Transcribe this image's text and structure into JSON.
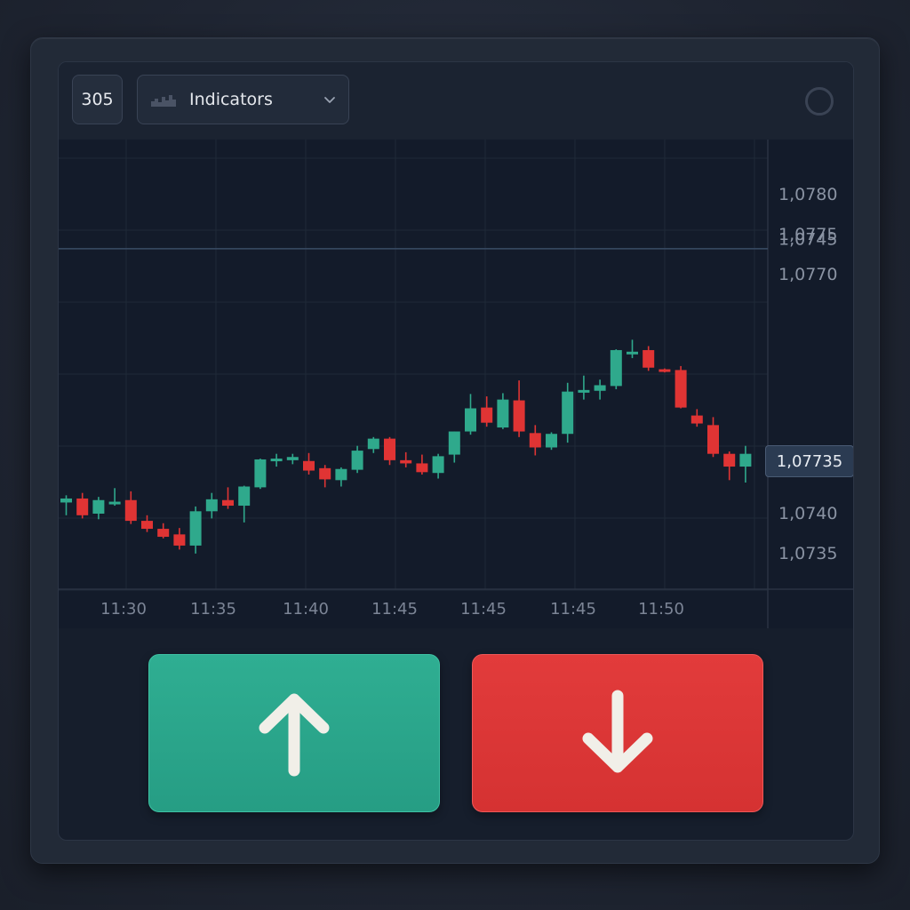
{
  "toolbar": {
    "timeframe_label": "305",
    "indicators_label": "Indicators",
    "indicators_icon": "bar-chart-icon",
    "dropdown_icon": "chevron-down-icon",
    "settings_icon": "circle-settings-icon"
  },
  "chart_data": {
    "type": "candlestick",
    "y_axis_labels": [
      "1,0780",
      "1,0775",
      "1,0770",
      "1,0745",
      "1,0740",
      "1,0735"
    ],
    "x_axis_labels": [
      "11:30",
      "11:35",
      "11:40",
      "11:45",
      "11:45",
      "11:45",
      "11:50"
    ],
    "current_price": "1,07735",
    "colors": {
      "up": "#2fa98c",
      "down": "#e03434",
      "background": "#131b2a",
      "grid": "#1f2938"
    },
    "candles": [
      {
        "dir": "up",
        "o": 1.07413,
        "h": 1.07422,
        "l": 1.07397,
        "c": 1.07418
      },
      {
        "dir": "down",
        "o": 1.07418,
        "h": 1.07425,
        "l": 1.07393,
        "c": 1.07397
      },
      {
        "dir": "up",
        "o": 1.07399,
        "h": 1.0742,
        "l": 1.07392,
        "c": 1.07416
      },
      {
        "dir": "up",
        "o": 1.07411,
        "h": 1.07431,
        "l": 1.07409,
        "c": 1.07414
      },
      {
        "dir": "down",
        "o": 1.07416,
        "h": 1.07427,
        "l": 1.07386,
        "c": 1.0739
      },
      {
        "dir": "down",
        "o": 1.0739,
        "h": 1.07397,
        "l": 1.07376,
        "c": 1.0738
      },
      {
        "dir": "down",
        "o": 1.0738,
        "h": 1.07387,
        "l": 1.07368,
        "c": 1.0737
      },
      {
        "dir": "down",
        "o": 1.07373,
        "h": 1.07381,
        "l": 1.07354,
        "c": 1.07359
      },
      {
        "dir": "up",
        "o": 1.07359,
        "h": 1.07408,
        "l": 1.07349,
        "c": 1.07402
      },
      {
        "dir": "up",
        "o": 1.07402,
        "h": 1.07425,
        "l": 1.07393,
        "c": 1.07417
      },
      {
        "dir": "down",
        "o": 1.07416,
        "h": 1.07432,
        "l": 1.07405,
        "c": 1.07409
      },
      {
        "dir": "up",
        "o": 1.07409,
        "h": 1.07434,
        "l": 1.07388,
        "c": 1.07433
      },
      {
        "dir": "up",
        "o": 1.07432,
        "h": 1.07468,
        "l": 1.0743,
        "c": 1.07467
      },
      {
        "dir": "up",
        "o": 1.07465,
        "h": 1.07474,
        "l": 1.07458,
        "c": 1.07468
      },
      {
        "dir": "up",
        "o": 1.07466,
        "h": 1.07474,
        "l": 1.07461,
        "c": 1.0747
      },
      {
        "dir": "down",
        "o": 1.07465,
        "h": 1.07475,
        "l": 1.07448,
        "c": 1.07453
      },
      {
        "dir": "down",
        "o": 1.07456,
        "h": 1.0746,
        "l": 1.07432,
        "c": 1.07442
      },
      {
        "dir": "up",
        "o": 1.07441,
        "h": 1.07457,
        "l": 1.07433,
        "c": 1.07455
      },
      {
        "dir": "up",
        "o": 1.07454,
        "h": 1.07484,
        "l": 1.0745,
        "c": 1.07478
      },
      {
        "dir": "up",
        "o": 1.0748,
        "h": 1.07495,
        "l": 1.07475,
        "c": 1.07493
      },
      {
        "dir": "down",
        "o": 1.07493,
        "h": 1.07495,
        "l": 1.0746,
        "c": 1.07466
      },
      {
        "dir": "down",
        "o": 1.07466,
        "h": 1.07476,
        "l": 1.07457,
        "c": 1.07462
      },
      {
        "dir": "down",
        "o": 1.07462,
        "h": 1.07473,
        "l": 1.07448,
        "c": 1.07451
      },
      {
        "dir": "up",
        "o": 1.0745,
        "h": 1.07474,
        "l": 1.07443,
        "c": 1.07471
      },
      {
        "dir": "up",
        "o": 1.07473,
        "h": 1.07502,
        "l": 1.07463,
        "c": 1.07502
      },
      {
        "dir": "up",
        "o": 1.07502,
        "h": 1.07549,
        "l": 1.07498,
        "c": 1.07531
      },
      {
        "dir": "down",
        "o": 1.07532,
        "h": 1.07546,
        "l": 1.07508,
        "c": 1.07513
      },
      {
        "dir": "up",
        "o": 1.07507,
        "h": 1.0755,
        "l": 1.07505,
        "c": 1.07542
      },
      {
        "dir": "down",
        "o": 1.07541,
        "h": 1.07566,
        "l": 1.07495,
        "c": 1.07502
      },
      {
        "dir": "down",
        "o": 1.075,
        "h": 1.0751,
        "l": 1.07472,
        "c": 1.07482
      },
      {
        "dir": "up",
        "o": 1.07482,
        "h": 1.07501,
        "l": 1.07479,
        "c": 1.07499
      },
      {
        "dir": "up",
        "o": 1.07499,
        "h": 1.07563,
        "l": 1.07488,
        "c": 1.07552
      },
      {
        "dir": "up",
        "o": 1.07551,
        "h": 1.07572,
        "l": 1.07542,
        "c": 1.07554
      },
      {
        "dir": "up",
        "o": 1.07553,
        "h": 1.07567,
        "l": 1.07542,
        "c": 1.0756
      },
      {
        "dir": "up",
        "o": 1.07559,
        "h": 1.07605,
        "l": 1.07555,
        "c": 1.07604
      },
      {
        "dir": "up",
        "o": 1.076,
        "h": 1.07617,
        "l": 1.07594,
        "c": 1.07602
      },
      {
        "dir": "down",
        "o": 1.07604,
        "h": 1.07609,
        "l": 1.07578,
        "c": 1.07582
      },
      {
        "dir": "down",
        "o": 1.0758,
        "h": 1.07581,
        "l": 1.07576,
        "c": 1.07578
      },
      {
        "dir": "down",
        "o": 1.07579,
        "h": 1.07584,
        "l": 1.07531,
        "c": 1.07532
      },
      {
        "dir": "down",
        "o": 1.07522,
        "h": 1.0753,
        "l": 1.07508,
        "c": 1.07512
      },
      {
        "dir": "down",
        "o": 1.0751,
        "h": 1.0752,
        "l": 1.0747,
        "c": 1.07474
      },
      {
        "dir": "down",
        "o": 1.07474,
        "h": 1.07477,
        "l": 1.07441,
        "c": 1.07458
      },
      {
        "dir": "up",
        "o": 1.07458,
        "h": 1.07484,
        "l": 1.07438,
        "c": 1.07474
      }
    ]
  },
  "buttons": {
    "up_icon": "arrow-up-icon",
    "down_icon": "arrow-down-icon",
    "up_color": "#2fae92",
    "down_color": "#e23b3b"
  }
}
